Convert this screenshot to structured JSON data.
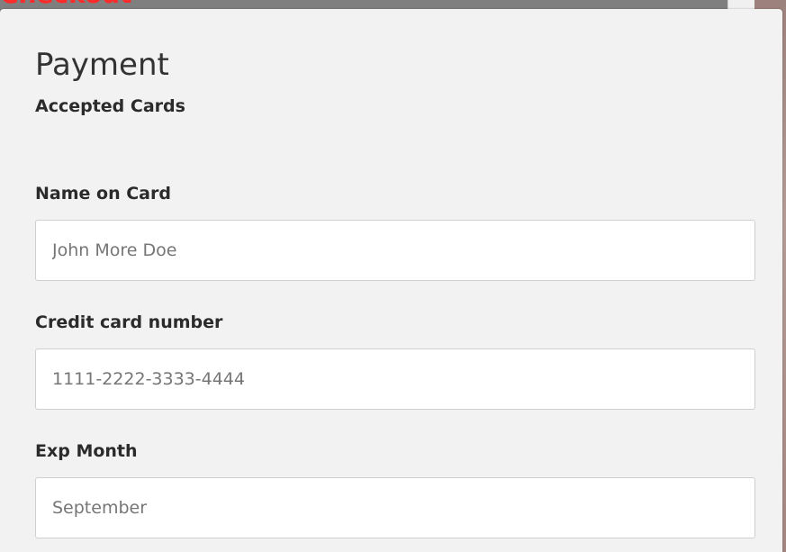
{
  "page": {
    "top_heading": "Checkout"
  },
  "payment": {
    "title": "Payment",
    "accepted_cards_label": "Accepted Cards",
    "name_label": "Name on Card",
    "name_placeholder": "John More Doe",
    "card_label": "Credit card number",
    "card_placeholder": "1111-2222-3333-4444",
    "exp_month_label": "Exp Month",
    "exp_month_placeholder": "September"
  },
  "colors": {
    "heading_accent": "#ff2a2a",
    "panel_background": "#f2f2f2",
    "text": "#2b2b2b",
    "input_border": "#cfcfcf"
  }
}
